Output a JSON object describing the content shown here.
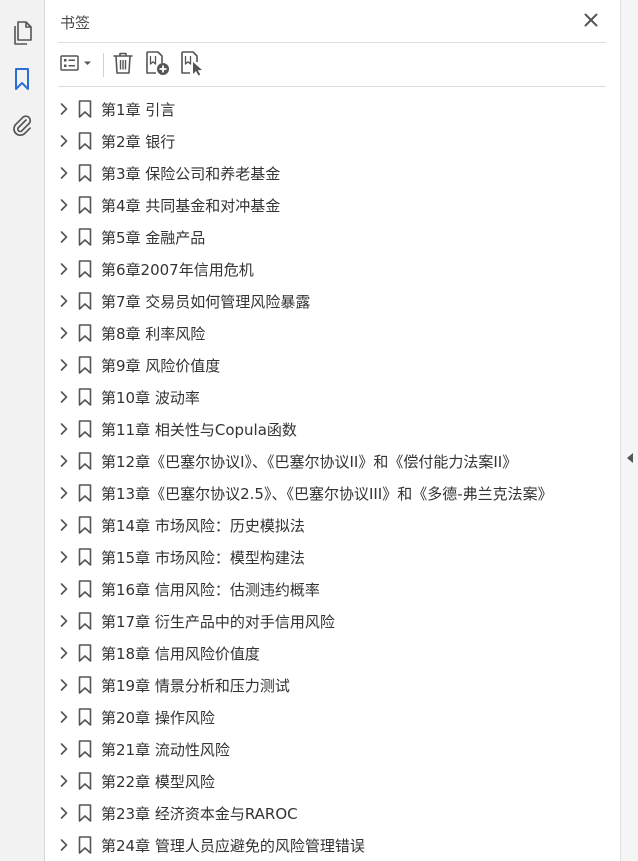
{
  "colors": {
    "icon_gray": "#555555",
    "active_blue": "#2b6fd6",
    "text": "#333333",
    "title": "#4a4a4a"
  },
  "rail": {
    "items": [
      {
        "icon": "pages-icon",
        "active": false
      },
      {
        "icon": "bookmark-icon",
        "active": true
      },
      {
        "icon": "attachment-icon",
        "active": false
      }
    ]
  },
  "panel": {
    "title": "书签",
    "close_icon": "close-icon"
  },
  "toolbar": {
    "buttons": [
      "options-menu-icon",
      "delete-icon",
      "new-bookmark-icon",
      "find-bookmark-icon"
    ]
  },
  "bookmarks": [
    {
      "label": "第1章  引言"
    },
    {
      "label": "第2章  银行"
    },
    {
      "label": "第3章  保险公司和养老基金"
    },
    {
      "label": "第4章  共同基金和对冲基金"
    },
    {
      "label": "第5章  金融产品"
    },
    {
      "label": "第6章2007年信用危机"
    },
    {
      "label": "第7章  交易员如何管理风险暴露"
    },
    {
      "label": "第8章  利率风险"
    },
    {
      "label": "第9章  风险价值度"
    },
    {
      "label": "第10章  波动率"
    },
    {
      "label": "第11章  相关性与Copula函数"
    },
    {
      "label": "第12章《巴塞尔协议I》、《巴塞尔协议II》和《偿付能力法案II》"
    },
    {
      "label": "第13章《巴塞尔协议2.5》、《巴塞尔协议III》和《多德-弗兰克法案》"
    },
    {
      "label": "第14章  市场风险：历史模拟法"
    },
    {
      "label": "第15章  市场风险：模型构建法"
    },
    {
      "label": "第16章  信用风险：估测违约概率"
    },
    {
      "label": "第17章  衍生产品中的对手信用风险"
    },
    {
      "label": "第18章  信用风险价值度"
    },
    {
      "label": "第19章  情景分析和压力测试"
    },
    {
      "label": "第20章  操作风险"
    },
    {
      "label": "第21章  流动性风险"
    },
    {
      "label": "第22章  模型风险"
    },
    {
      "label": "第23章  经济资本金与RAROC"
    },
    {
      "label": "第24章  管理人员应避免的风险管理错误"
    }
  ]
}
